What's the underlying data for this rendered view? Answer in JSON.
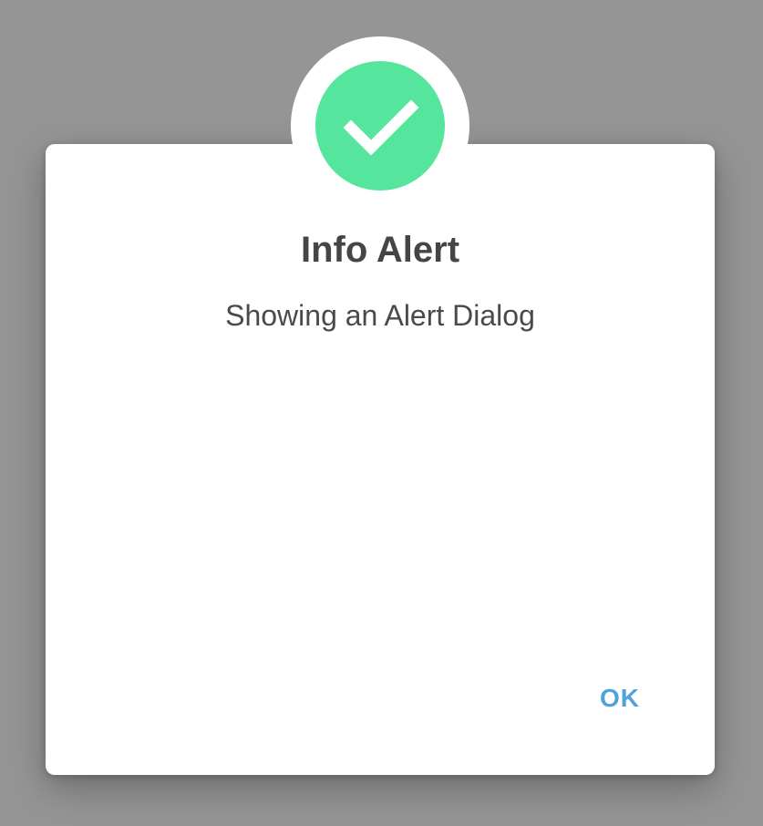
{
  "dialog": {
    "title": "Info Alert",
    "message": "Showing an Alert Dialog",
    "ok_label": "OK",
    "icon": "check-circle-icon"
  },
  "colors": {
    "scrim": "#959595",
    "badge": "#55e59d",
    "button_text": "#4fa3d9",
    "title_text": "#454545"
  }
}
